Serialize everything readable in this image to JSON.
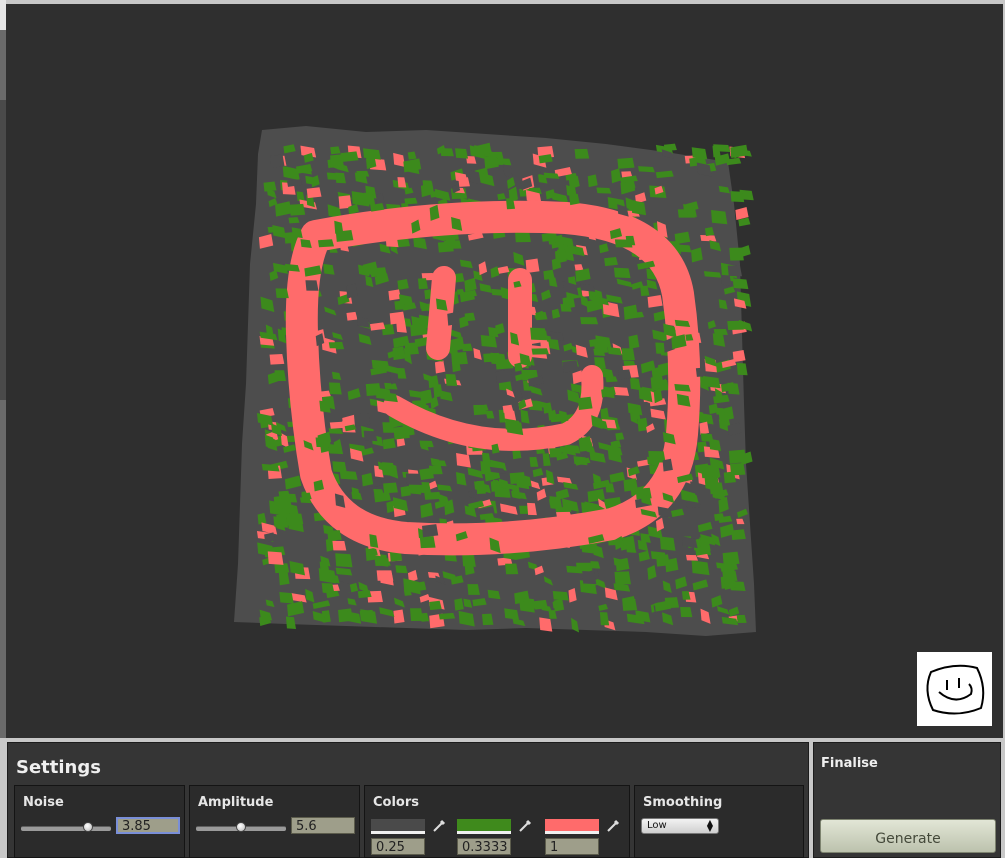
{
  "settings": {
    "title": "Settings",
    "noise": {
      "label": "Noise",
      "value": "3.85",
      "slider_fraction": 0.74
    },
    "amplitude": {
      "label": "Amplitude",
      "value": "5.6",
      "slider_fraction": 0.5
    },
    "colors": {
      "label": "Colors",
      "items": [
        {
          "color": "#4a4a4a",
          "value": "0.25"
        },
        {
          "color": "#3f8a1c",
          "value": "0.3333"
        },
        {
          "color": "#ff6b6b",
          "value": "1"
        }
      ]
    },
    "smoothing": {
      "label": "Smoothing",
      "selected": "Low"
    }
  },
  "finalise": {
    "title": "Finalise",
    "generate_label": "Generate"
  },
  "terrain_colors": {
    "base": "#4d4d4d",
    "grass": "#3c8a1c",
    "highlight": "#ff6b6b",
    "background": "#2f2f2f"
  }
}
